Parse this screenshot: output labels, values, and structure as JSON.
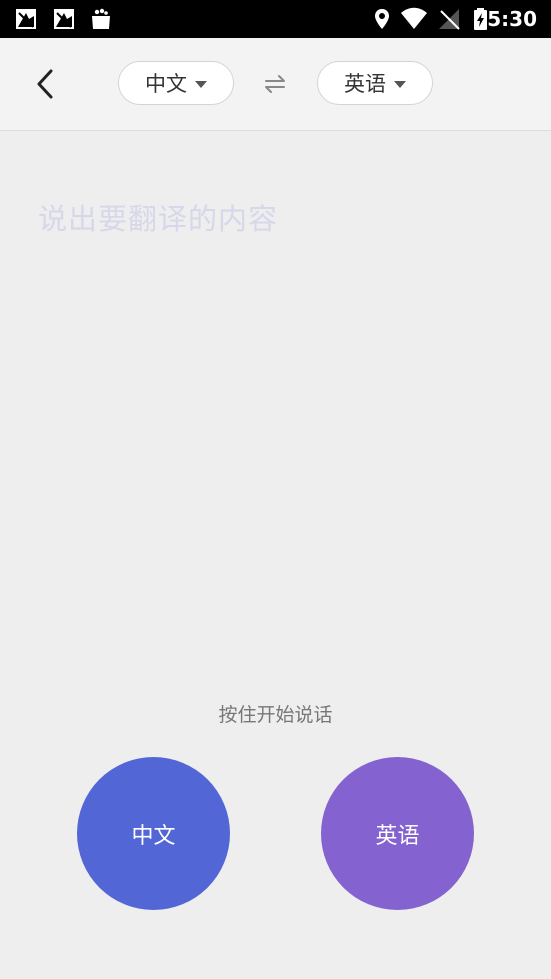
{
  "status_bar": {
    "time": "5:30",
    "icons": [
      "notification-image-icon",
      "notification-image-icon",
      "shopping-bag-icon",
      "location-icon",
      "wifi-icon",
      "no-signal-icon",
      "battery-charging-icon"
    ]
  },
  "header": {
    "back_icon": "chevron-left-icon",
    "source_language": "中文",
    "target_language": "英语",
    "swap_icon": "swap-arrows-icon"
  },
  "main": {
    "placeholder": "说出要翻译的内容",
    "hint": "按住开始说话"
  },
  "buttons": {
    "source_label": "中文",
    "target_label": "英语",
    "source_color": "#5266d5",
    "target_color": "#8462cf"
  }
}
